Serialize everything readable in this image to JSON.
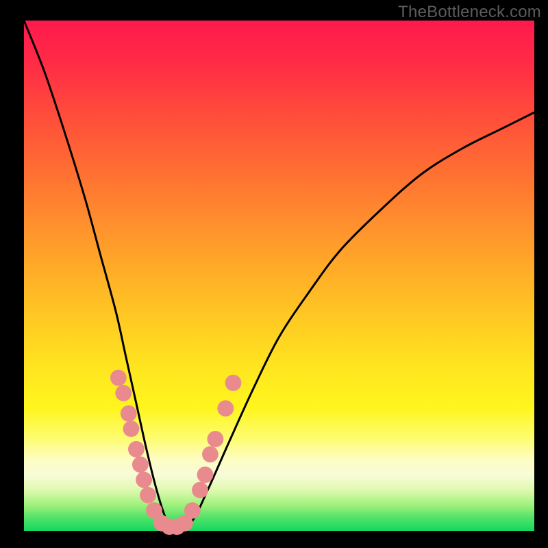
{
  "watermark": "TheBottleneck.com",
  "colors": {
    "frame": "#000000",
    "gradient_top": "#ff1a4d",
    "gradient_bottom": "#14d85e",
    "curve": "#000000",
    "marker": "#e98a8f"
  },
  "chart_data": {
    "type": "line",
    "title": "",
    "xlabel": "",
    "ylabel": "",
    "xlim": [
      0,
      100
    ],
    "ylim": [
      0,
      100
    ],
    "grid": false,
    "legend": false,
    "note": "Axes are normalized 0–100 percent of plot width/height. Origin is bottom-left. Curve is a V-shaped bottleneck profile with minimum ≈0 near x≈25–30.",
    "series": [
      {
        "name": "bottleneck-curve",
        "x": [
          0,
          4,
          8,
          12,
          15,
          18,
          20,
          22,
          24,
          26,
          28,
          30,
          33,
          36,
          40,
          45,
          50,
          56,
          62,
          70,
          78,
          86,
          94,
          100
        ],
        "y": [
          100,
          90,
          78,
          65,
          54,
          43,
          34,
          25,
          16,
          8,
          2,
          0,
          2,
          8,
          17,
          28,
          38,
          47,
          55,
          63,
          70,
          75,
          79,
          82
        ]
      }
    ],
    "markers": {
      "name": "highlighted-points",
      "note": "Salmon dots clustered on both flanks near the trough and along the bottom.",
      "points": [
        {
          "x": 18.5,
          "y": 30
        },
        {
          "x": 19.5,
          "y": 27
        },
        {
          "x": 20.5,
          "y": 23
        },
        {
          "x": 21.0,
          "y": 20
        },
        {
          "x": 22.0,
          "y": 16
        },
        {
          "x": 22.8,
          "y": 13
        },
        {
          "x": 23.5,
          "y": 10
        },
        {
          "x": 24.3,
          "y": 7
        },
        {
          "x": 25.5,
          "y": 4
        },
        {
          "x": 27.0,
          "y": 1.5
        },
        {
          "x": 28.5,
          "y": 0.8
        },
        {
          "x": 30.0,
          "y": 0.8
        },
        {
          "x": 31.5,
          "y": 1.5
        },
        {
          "x": 33.0,
          "y": 4
        },
        {
          "x": 34.5,
          "y": 8
        },
        {
          "x": 35.5,
          "y": 11
        },
        {
          "x": 36.5,
          "y": 15
        },
        {
          "x": 37.5,
          "y": 18
        },
        {
          "x": 39.5,
          "y": 24
        },
        {
          "x": 41.0,
          "y": 29
        }
      ],
      "radius_pct": 1.6
    }
  }
}
